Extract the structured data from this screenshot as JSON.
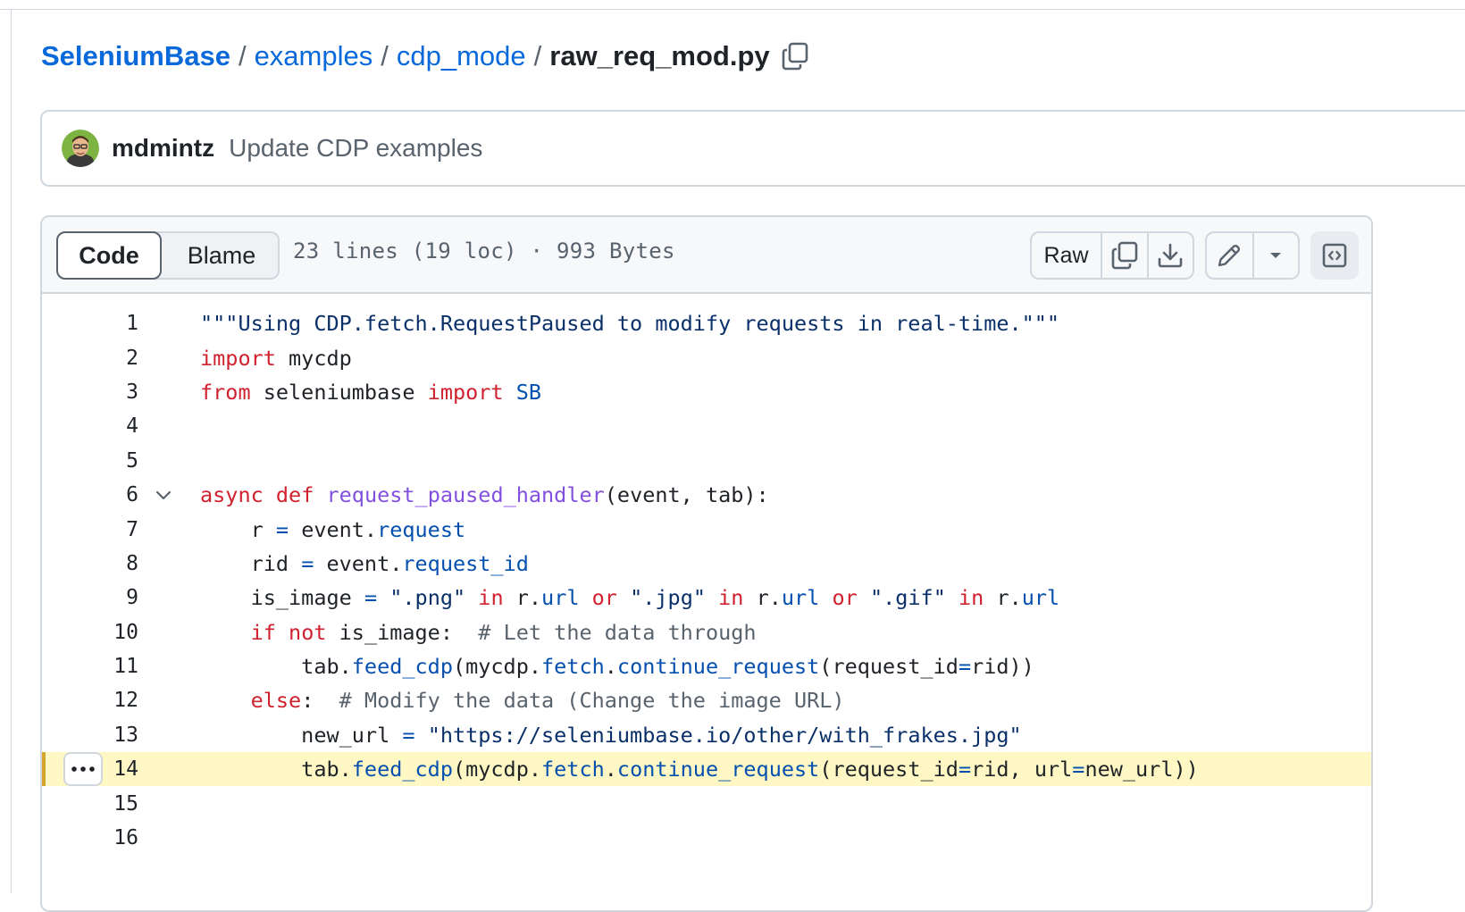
{
  "breadcrumb": {
    "repo": "SeleniumBase",
    "sep1": "/",
    "dir1": "examples",
    "sep2": "/",
    "dir2": "cdp_mode",
    "sep3": "/",
    "file": "raw_req_mod.py",
    "copy_icon": "copy-icon"
  },
  "commit": {
    "author": "mdmintz",
    "message": "Update CDP examples",
    "avatar_icon": "avatar"
  },
  "file_header": {
    "tab_code": "Code",
    "tab_blame": "Blame",
    "active_tab": "Code",
    "info": "23 lines (19 loc) · 993 Bytes",
    "raw_label": "Raw",
    "icons": [
      "copy-icon",
      "download-icon",
      "pencil-icon",
      "triangle-down-icon",
      "code-square-icon"
    ]
  },
  "code": {
    "highlighted_line": 14,
    "lines": [
      {
        "n": "1",
        "t": "\"\"\"Using CDP.fetch.RequestPaused to modify requests in real-time.\"\"\""
      },
      {
        "n": "2",
        "t": "import mycdp"
      },
      {
        "n": "3",
        "t": "from seleniumbase import SB"
      },
      {
        "n": "4",
        "t": ""
      },
      {
        "n": "5",
        "t": ""
      },
      {
        "n": "6",
        "t": "async def request_paused_handler(event, tab):"
      },
      {
        "n": "7",
        "t": "    r = event.request"
      },
      {
        "n": "8",
        "t": "    rid = event.request_id"
      },
      {
        "n": "9",
        "t": "    is_image = \".png\" in r.url or \".jpg\" in r.url or \".gif\" in r.url"
      },
      {
        "n": "10",
        "t": "    if not is_image:  # Let the data through"
      },
      {
        "n": "11",
        "t": "        tab.feed_cdp(mycdp.fetch.continue_request(request_id=rid))"
      },
      {
        "n": "12",
        "t": "    else:  # Modify the data (Change the image URL)"
      },
      {
        "n": "13",
        "t": "        new_url = \"https://seleniumbase.io/other/with_frakes.jpg\""
      },
      {
        "n": "14",
        "t": "        tab.feed_cdp(mycdp.fetch.continue_request(request_id=rid, url=new_url))"
      },
      {
        "n": "15",
        "t": ""
      },
      {
        "n": "16",
        "t": ""
      }
    ]
  }
}
